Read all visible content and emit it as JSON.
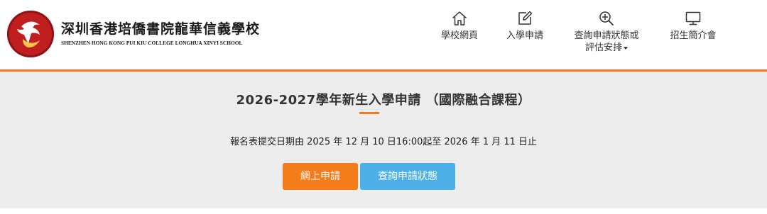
{
  "header": {
    "school_name_cn": "深圳香港培僑書院龍華信義學校",
    "school_name_en": "SHENZHEN HONG KONG PUI KIU COLLEGE LONGHUA XINYI SCHOOL",
    "logo_icon": "school-crest-icon"
  },
  "nav": {
    "home": {
      "label": "學校網頁",
      "icon": "home-icon"
    },
    "apply": {
      "label": "入學申請",
      "icon": "edit-icon"
    },
    "status": {
      "label_line1": "查詢申請狀態或",
      "label_line2": "評估安排",
      "icon": "search-plus-icon"
    },
    "intro": {
      "label": "招生簡介會",
      "icon": "monitor-icon"
    }
  },
  "main": {
    "title": "2026-2027學年新生入學申請 （國際融合課程）",
    "period": "報名表提交日期由 2025 年 12 月 10 日16:00起至 2026 年 1 月 11 日止",
    "apply_button": "網上申請",
    "status_button": "查詢申請狀態"
  },
  "colors": {
    "accent_orange": "#f47c1a",
    "accent_blue": "#4db0e6",
    "band_gray": "#ededed",
    "crest_red": "#c11f1f"
  }
}
